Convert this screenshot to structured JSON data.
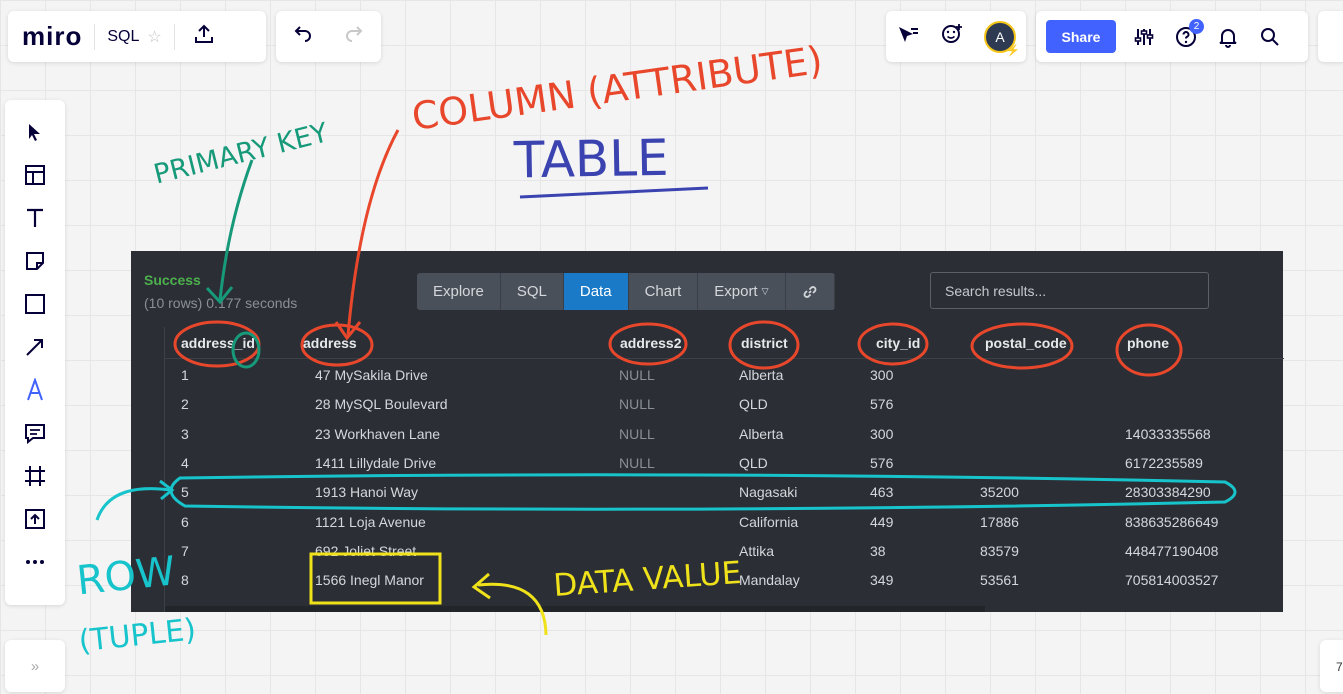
{
  "topbar": {
    "logo": "miro",
    "board_name": "SQL",
    "share_label": "Share",
    "help_badge": "2",
    "avatar_initial": "A"
  },
  "left_toolbar": {
    "tools": [
      "select-icon",
      "templates-icon",
      "text-icon",
      "sticky-note-icon",
      "shape-icon",
      "arrow-line-icon",
      "pen-icon",
      "comment-icon",
      "frame-icon",
      "upload-icon",
      "more-icon"
    ]
  },
  "bottom": {
    "collapse_icon": "»",
    "zoom_value": "7"
  },
  "query_panel": {
    "status": "Success",
    "rows_info": "(10 rows) 0.177 seconds",
    "tabs": [
      {
        "label": "Explore"
      },
      {
        "label": "SQL"
      },
      {
        "label": "Data"
      },
      {
        "label": "Chart"
      },
      {
        "label": "Export"
      }
    ],
    "active_tab": "Data",
    "search_placeholder": "Search results...",
    "columns": [
      "address_id",
      "address",
      "address2",
      "district",
      "city_id",
      "postal_code",
      "phone"
    ],
    "rows": [
      [
        "1",
        "47 MySakila Drive",
        "NULL",
        "Alberta",
        "300",
        "",
        ""
      ],
      [
        "2",
        "28 MySQL Boulevard",
        "NULL",
        "QLD",
        "576",
        "",
        ""
      ],
      [
        "3",
        "23 Workhaven Lane",
        "NULL",
        "Alberta",
        "300",
        "",
        "14033335568"
      ],
      [
        "4",
        "1411 Lillydale Drive",
        "NULL",
        "QLD",
        "576",
        "",
        "6172235589"
      ],
      [
        "5",
        "1913 Hanoi Way",
        "",
        "Nagasaki",
        "463",
        "35200",
        "28303384290"
      ],
      [
        "6",
        "1121 Loja Avenue",
        "",
        "California",
        "449",
        "17886",
        "838635286649"
      ],
      [
        "7",
        "692 Joliet Street",
        "",
        "Attika",
        "38",
        "83579",
        "448477190408"
      ],
      [
        "8",
        "1566 Inegl Manor",
        "",
        "Mandalay",
        "349",
        "53561",
        "705814003527"
      ]
    ]
  },
  "annotations": {
    "table_title": "TABLE",
    "primary_key": "PRIMARY KEY",
    "column": "COLUMN (ATTRIBUTE)",
    "row_line1": "ROW",
    "row_line2": "(TUPLE)",
    "data_value": "DATA VALUE"
  },
  "colors": {
    "share": "#4262ff",
    "panel_bg": "#2b2f35",
    "active_tab": "#1a7ac7",
    "annot_red": "#e8472b",
    "annot_green": "#179a7a",
    "annot_cyan": "#18c4cc",
    "annot_yellow": "#f0e21a",
    "annot_blue": "#3a43b0"
  }
}
